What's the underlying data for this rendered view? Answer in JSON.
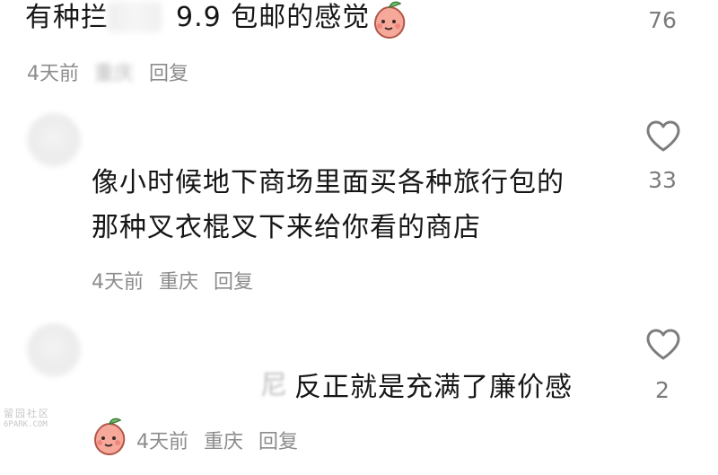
{
  "comments": [
    {
      "text_a": "有种拦",
      "text_b": "9.9 包邮的感觉",
      "meta": {
        "time": "4天前",
        "location": "重庆",
        "reply": "回复"
      },
      "likes": "76",
      "emoji": "peach-face-icon"
    },
    {
      "text_line1": "像小时候地下商场里面买各种旅行包的",
      "text_line2": "那种叉衣棍叉下来给你看的商店",
      "meta": {
        "time": "4天前",
        "location": "重庆",
        "reply": "回复"
      },
      "likes": "33"
    },
    {
      "text_prefix": "尼",
      "text": "反正就是充满了廉价感",
      "meta": {
        "time": "4天前",
        "location": "重庆",
        "reply": "回复"
      },
      "likes": "2"
    }
  ],
  "watermark": {
    "line1": "留园社区",
    "line2": "6PARK.COM"
  },
  "colors": {
    "text": "#161616",
    "meta": "#8c8c8c",
    "heart": "#7d7d7d"
  }
}
